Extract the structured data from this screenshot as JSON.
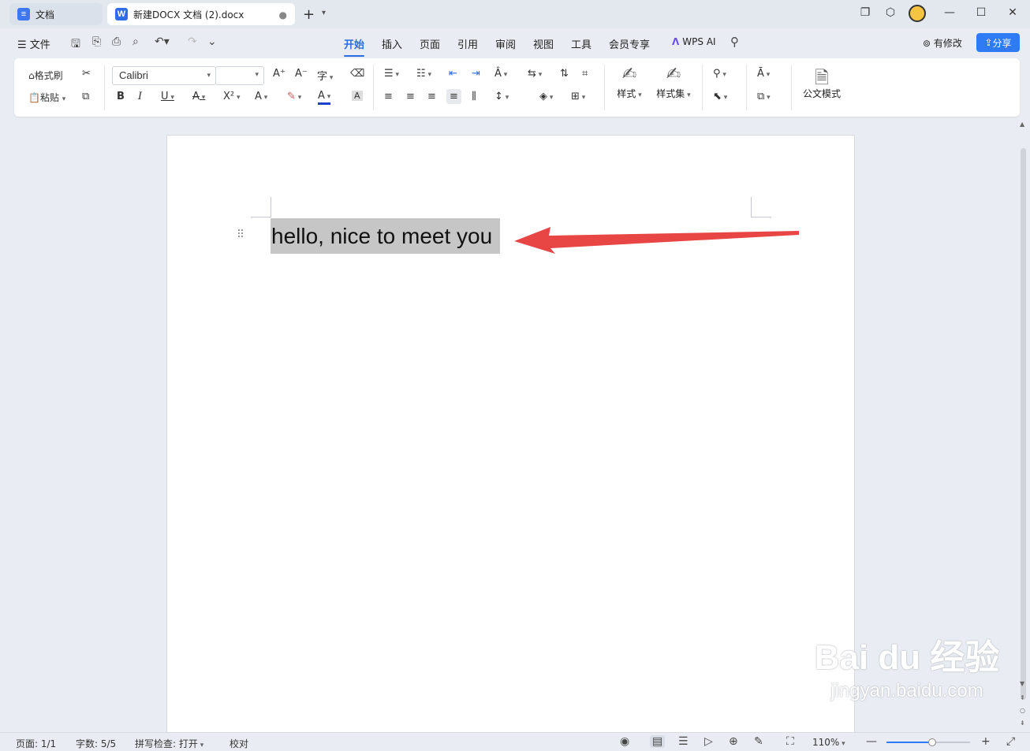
{
  "tabs": [
    {
      "label": "文档"
    },
    {
      "label": "新建DOCX 文档 (2).docx"
    }
  ],
  "titlebar": {
    "new_tab": "+"
  },
  "menu": {
    "file": "文件",
    "tabs": [
      "开始",
      "插入",
      "页面",
      "引用",
      "审阅",
      "视图",
      "工具",
      "会员专享"
    ],
    "active_tab": "开始",
    "wps_ai": "WPS AI",
    "modified": "有修改",
    "share": "分享"
  },
  "ribbon": {
    "format_painter": "格式刷",
    "paste": "粘贴",
    "font_name": "Calibri",
    "font_size": "",
    "styles": "样式",
    "style_set": "样式集",
    "official_mode": "公文模式"
  },
  "document": {
    "text": "hello, nice to meet you"
  },
  "annotation": {
    "arrow_color": "#e84545"
  },
  "watermark": {
    "main": "Bai du 经验",
    "sub": "jingyan.baidu.com"
  },
  "status": {
    "page": "页面: 1/1",
    "word_count": "字数: 5/5",
    "spell_check": "拼写检查: 打开",
    "proofread": "校对",
    "zoom": "110%",
    "zoom_level": 0.55
  },
  "colors": {
    "accent": "#2a6de0",
    "share_button": "#2f7bf5"
  }
}
